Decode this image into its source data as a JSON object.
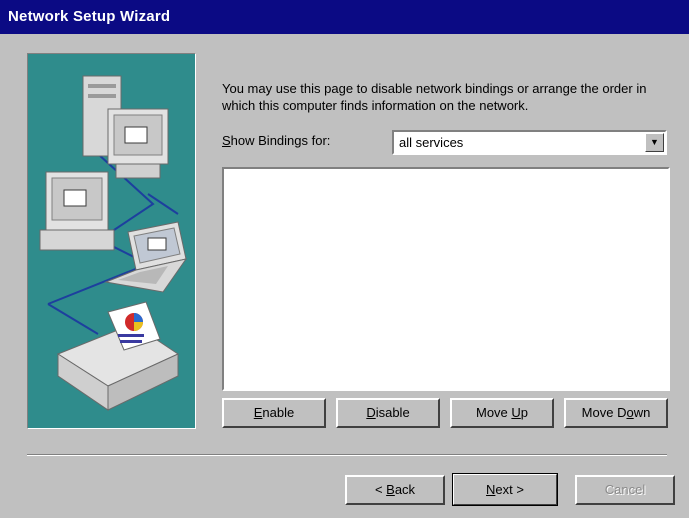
{
  "window": {
    "title": "Network Setup Wizard"
  },
  "page": {
    "description": "You may use this page to disable network bindings or arrange the order in which this computer finds information on the network.",
    "bindings_label_accel": "S",
    "bindings_label_rest": "how Bindings for:",
    "bindings_select": {
      "value": "all services"
    },
    "bindings_list": []
  },
  "actions": {
    "enable": {
      "accel": "E",
      "rest": "nable"
    },
    "disable": {
      "accel": "D",
      "rest": "isable"
    },
    "move_up": {
      "pre": "Move ",
      "accel": "U",
      "rest": "p"
    },
    "move_down": {
      "pre": "Move D",
      "accel": "o",
      "rest": "wn"
    }
  },
  "footer": {
    "back": {
      "pre": "< ",
      "accel": "B",
      "rest": "ack"
    },
    "next": {
      "accel": "N",
      "rest": "ext >"
    },
    "cancel": "Cancel"
  },
  "colors": {
    "title_bar": "#0b0a84",
    "dialog_face": "#c0c0c0",
    "illustration_bg": "#2f8c8c",
    "network_line": "#1d3f9e"
  },
  "icons": [
    "computer-icon",
    "laptop-icon",
    "printer-icon",
    "dropdown-arrow-icon"
  ]
}
